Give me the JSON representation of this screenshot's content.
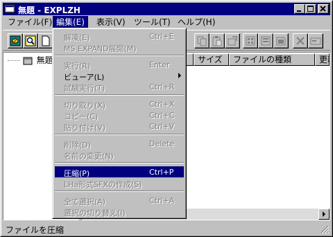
{
  "window": {
    "title": "無題 - EXPLZH"
  },
  "menubar": {
    "items": [
      {
        "label": "ファイル(F)"
      },
      {
        "label": "編集(E)"
      },
      {
        "label": "表示(V)"
      },
      {
        "label": "ツール(T)"
      },
      {
        "label": "ヘルプ(H)"
      }
    ],
    "active_index": 1
  },
  "tree": {
    "root_label": "無題"
  },
  "list": {
    "columns": [
      {
        "label": ""
      },
      {
        "label": "サイズ"
      },
      {
        "label": "ファイルの種類"
      },
      {
        "label": "更新"
      }
    ]
  },
  "edit_menu": {
    "groups": [
      [
        {
          "label": "解凍(E)",
          "shortcut": "Ctrl+E",
          "enabled": false
        },
        {
          "label": "MS EXPAND展開(M)",
          "shortcut": "",
          "enabled": false
        }
      ],
      [
        {
          "label": "実行(R)",
          "shortcut": "Enter",
          "enabled": false
        },
        {
          "label": "ビューア(L)",
          "shortcut": "",
          "enabled": true,
          "submenu": true
        },
        {
          "label": "試験実行(T)",
          "shortcut": "Ctrl+R",
          "enabled": false
        }
      ],
      [
        {
          "label": "切り取り(X)",
          "shortcut": "Ctrl+X",
          "enabled": false
        },
        {
          "label": "コピー(C)",
          "shortcut": "Ctrl+C",
          "enabled": false
        },
        {
          "label": "貼り付け(V)",
          "shortcut": "Ctrl+V",
          "enabled": false
        }
      ],
      [
        {
          "label": "削除(D)",
          "shortcut": "Delete",
          "enabled": false
        },
        {
          "label": "名前の変更(N)",
          "shortcut": "",
          "enabled": false
        }
      ],
      [
        {
          "label": "圧縮(P)",
          "shortcut": "Ctrl+P",
          "enabled": true,
          "highlighted": true
        },
        {
          "label": "LHa形式SFXの作成(S)",
          "shortcut": "",
          "enabled": false
        }
      ],
      [
        {
          "label": "全て選択(A)",
          "shortcut": "Ctrl+A",
          "enabled": false
        },
        {
          "label": "選択の切り替え(I)",
          "shortcut": "",
          "enabled": false
        }
      ]
    ]
  },
  "statusbar": {
    "text": "ファイルを圧縮"
  },
  "colors": {
    "titlebar": "#000080",
    "face": "#c0c0c0",
    "highlight": "#000080",
    "disabled_text": "#808080"
  }
}
